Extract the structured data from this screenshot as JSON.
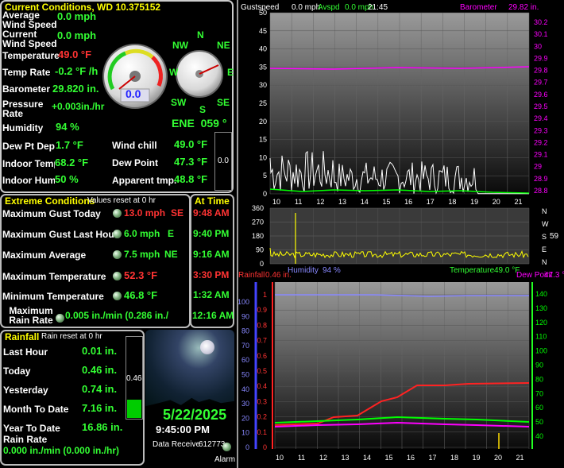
{
  "current": {
    "title": "Current Conditions, WD 10.375152",
    "rows": [
      {
        "label": "Average Wind Speed",
        "value": "0.0 mph"
      },
      {
        "label": "Current Wind Speed",
        "value": "0.0 mph"
      },
      {
        "label": "Temperature",
        "value": "49.0 °F"
      },
      {
        "label": "Temp Rate",
        "value": "-0.2 °F /h"
      },
      {
        "label": "Barometer",
        "value": "29.820 in."
      },
      {
        "label": "Pressure Rate",
        "value": "+0.003in./hr"
      },
      {
        "label": "Humidity",
        "value": "94 %"
      },
      {
        "label": "Dew Pt Dep",
        "value": "1.7 °F"
      },
      {
        "label": "Indoor Temp",
        "value": "68.2 °F"
      },
      {
        "label": "Indoor Hum",
        "value": "50 %"
      }
    ],
    "windchill_label": "Wind chill",
    "windchill_value": "49.0 °F",
    "dewpoint_label": "Dew Point",
    "dewpoint_value": "47.3 °F",
    "apparent_label": "Apparent tmp.",
    "apparent_value": "48.8 °F",
    "small_box_value": "0.0",
    "speed_gauge_value": "0.0",
    "compass": {
      "n": "N",
      "nw": "NW",
      "ne": "NE",
      "w": "W",
      "e": "E",
      "sw": "SW",
      "s": "S",
      "se": "SE",
      "reading": "ENE  059 °"
    }
  },
  "extreme": {
    "title": "Extreme Conditions",
    "subtitle": "Values reset at 0 hr",
    "at_time_title": "At Time",
    "rows": [
      {
        "label": "Maximum Gust Today",
        "value": "13.0 mph",
        "dir": "SE",
        "time": "9:48 AM",
        "hot": true
      },
      {
        "label": "Maximum Gust Last Hour",
        "value": "6.0 mph",
        "dir": "E",
        "time": "9:40 PM",
        "hot": false
      },
      {
        "label": "Maximum Average",
        "value": "7.5 mph",
        "dir": "NE",
        "time": "9:16 AM",
        "hot": false
      },
      {
        "label": "Maximum Temperature",
        "value": "52.3 °F",
        "dir": "",
        "time": "3:30 PM",
        "hot": true
      },
      {
        "label": "Minimum Temperature",
        "value": "46.8 °F",
        "dir": "",
        "time": "1:32 AM",
        "hot": false
      }
    ],
    "max_rain_label": "Maximum Rain Rate",
    "max_rain_value": "0.005 in./min (0.286 in./",
    "max_rain_time": "12:16 AM"
  },
  "rainfall": {
    "title": "Rainfall",
    "subtitle": "Rain reset at 0 hr",
    "rows": [
      {
        "label": "Last Hour",
        "value": "0.01 in."
      },
      {
        "label": "Today",
        "value": "0.46 in."
      },
      {
        "label": "Yesterday",
        "value": "0.74 in."
      },
      {
        "label": "Month To Date",
        "value": "7.16 in."
      },
      {
        "label": "Year To Date",
        "value": "16.86 in."
      }
    ],
    "rain_rate_label": "Rain Rate",
    "rain_rate_value": "0.000 in./min (0.000 in./hr)",
    "gauge_value": "0.46",
    "gauge_fill": 0.46
  },
  "footer": {
    "date": "5/22/2025",
    "time": "9:45:00 PM",
    "data_received_label": "Data Receive",
    "data_received_value": "612773",
    "alarm_label": "Alarm"
  },
  "graphs": {
    "wind_header": {
      "gust": "Gustspeed",
      "gust_val": "0.0 mph",
      "avg": "Avspd",
      "avg_val": "0.0 mph",
      "time": "21:45",
      "baro": "Barometer",
      "baro_val": "29.82 in."
    },
    "hours": [
      "10",
      "11",
      "12",
      "13",
      "14",
      "15",
      "16",
      "17",
      "18",
      "19",
      "20",
      "21"
    ],
    "wind_left_ticks": [
      "50",
      "45",
      "40",
      "35",
      "30",
      "25",
      "20",
      "15",
      "10",
      "5",
      "0"
    ],
    "baro_ticks": [
      "30.2",
      "30.1",
      "30",
      "29.9",
      "29.8",
      "29.7",
      "29.6",
      "29.5",
      "29.4",
      "29.3",
      "29.2",
      "29.1",
      "29",
      "28.9",
      "28.8"
    ],
    "dir_ticks": [
      "360",
      "270",
      "180",
      "90",
      "0"
    ],
    "dir_right": [
      "N",
      "W",
      "S",
      "E",
      "N"
    ],
    "dir_value": "59",
    "humidity_label": "Humidity",
    "humidity_val": "94 %",
    "temp_label": "Temperature",
    "temp_val": "49.0 °F",
    "rain_label": "Rainfall",
    "rain_val": "0.46 in.",
    "dew_label": "Dew Point",
    "dew_val": "47.3 °F",
    "left_hum_ticks": [
      "100",
      "90",
      "80",
      "70",
      "60",
      "50",
      "40",
      "30",
      "20",
      "10",
      "0"
    ],
    "rain_ticks": [
      "1",
      "0.9",
      "0.8",
      "0.7",
      "0.6",
      "0.5",
      "0.4",
      "0.3",
      "0.2",
      "0.1",
      "0"
    ],
    "temp_ticks": [
      "140",
      "130",
      "120",
      "110",
      "100",
      "90",
      "80",
      "70",
      "60",
      "50",
      "40"
    ],
    "colors": {
      "gust": "#ffffff",
      "avg": "#00ff00",
      "baro": "#ff00ff",
      "dir": "#ffff00",
      "rain": "#ff2020",
      "hum": "#8080ff",
      "temp": "#00ff00",
      "dew": "#ff00ff"
    }
  }
}
